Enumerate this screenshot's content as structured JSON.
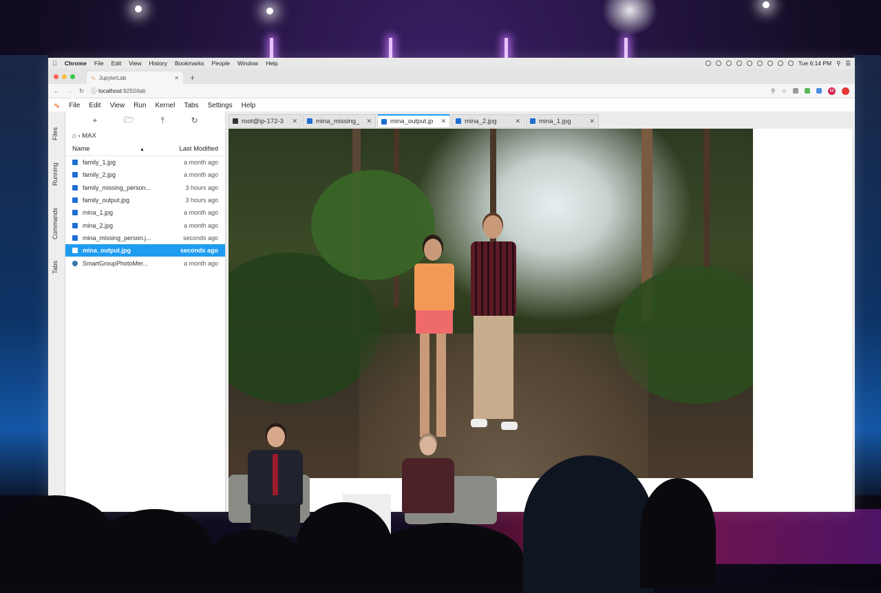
{
  "mac_menubar": {
    "app": "Chrome",
    "menus": [
      "File",
      "Edit",
      "View",
      "History",
      "Bookmarks",
      "People",
      "Window",
      "Help"
    ],
    "clock": "Tue 6:14 PM"
  },
  "browser": {
    "tab_title": "JupyterLab",
    "url_host": "localhost",
    "url_rest": ":9250/lab"
  },
  "jupyter": {
    "menus": [
      "File",
      "Edit",
      "View",
      "Run",
      "Kernel",
      "Tabs",
      "Settings",
      "Help"
    ],
    "sidebar_tabs": [
      "Files",
      "Running",
      "Commands",
      "Tabs"
    ],
    "breadcrumb": "MAX",
    "columns": {
      "name": "Name",
      "modified": "Last Modified"
    },
    "files": [
      {
        "name": "family_1.jpg",
        "modified": "a month ago",
        "type": "image"
      },
      {
        "name": "family_2.jpg",
        "modified": "a month ago",
        "type": "image"
      },
      {
        "name": "family_missing_person...",
        "modified": "3 hours ago",
        "type": "image"
      },
      {
        "name": "family_output.jpg",
        "modified": "3 hours ago",
        "type": "image"
      },
      {
        "name": "mina_1.jpg",
        "modified": "a month ago",
        "type": "image"
      },
      {
        "name": "mina_2.jpg",
        "modified": "a month ago",
        "type": "image"
      },
      {
        "name": "mina_missing_person.j...",
        "modified": "seconds ago",
        "type": "image"
      },
      {
        "name": "mina_output.jpg",
        "modified": "seconds ago",
        "type": "image",
        "selected": true
      },
      {
        "name": "SmartGroupPhotoMer...",
        "modified": "a month ago",
        "type": "python"
      }
    ],
    "doc_tabs": [
      {
        "label": "root@ip-172-3",
        "icon": "terminal-icon"
      },
      {
        "label": "mina_missing_",
        "icon": "image-icon"
      },
      {
        "label": "mina_output.jp",
        "icon": "image-icon",
        "active": true
      },
      {
        "label": "mina_2.jpg",
        "icon": "image-icon"
      },
      {
        "label": "mina_1.jpg",
        "icon": "image-icon"
      }
    ]
  },
  "colors": {
    "selection": "#1e9cf0",
    "jupyter_orange": "#f37726"
  }
}
